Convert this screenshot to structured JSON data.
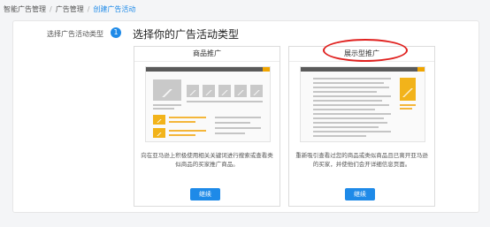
{
  "breadcrumb": [
    "智能广告管理",
    "广告管理",
    "创建广告活动"
  ],
  "step": {
    "label": "选择广告活动类型",
    "number": "1",
    "title": "选择你的广告活动类型"
  },
  "cards": [
    {
      "title": "商品推广",
      "description": "向在亚马逊上积极使用相关关键词进行搜索或查看类似商品的买家推广商品。",
      "button": "继续"
    },
    {
      "title": "展示型推广",
      "description": "重新吸引查看过您的商品或类似商品且已离开亚马逊的买家，并使他们会开详细信息页面。",
      "button": "继续"
    }
  ],
  "colors": {
    "accent": "#1e8ae8",
    "highlight": "#f2b31a",
    "annotation": "#e0211f"
  }
}
